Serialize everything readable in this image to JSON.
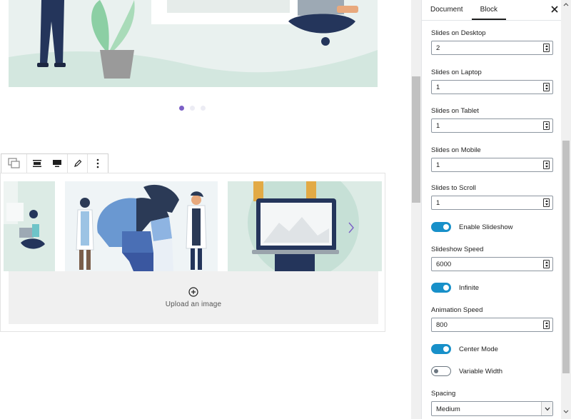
{
  "sidebar": {
    "tabs": [
      {
        "label": "Document",
        "active": false
      },
      {
        "label": "Block",
        "active": true
      }
    ],
    "close_icon": "close-icon",
    "fields": {
      "slides_desktop": {
        "label": "Slides on Desktop",
        "value": "2"
      },
      "slides_laptop": {
        "label": "Slides on Laptop",
        "value": "1"
      },
      "slides_tablet": {
        "label": "Slides on Tablet",
        "value": "1"
      },
      "slides_mobile": {
        "label": "Slides on Mobile",
        "value": "1"
      },
      "slides_scroll": {
        "label": "Slides to Scroll",
        "value": "1"
      },
      "slideshow_speed": {
        "label": "Slideshow Speed",
        "value": "6000"
      },
      "animation_speed": {
        "label": "Animation Speed",
        "value": "800"
      }
    },
    "toggles": {
      "enable_slideshow": {
        "label": "Enable Slideshow",
        "on": true
      },
      "infinite": {
        "label": "Infinite",
        "on": true
      },
      "center_mode": {
        "label": "Center Mode",
        "on": true
      },
      "variable_width": {
        "label": "Variable Width",
        "on": false
      }
    },
    "spacing": {
      "label": "Spacing",
      "selected": "Medium"
    }
  },
  "editor": {
    "carousel_dots": {
      "count": 3,
      "active_index": 0
    },
    "block_toolbar": [
      "gallery-icon",
      "align-center-icon",
      "align-wide-icon",
      "pencil-icon",
      "more-vertical-icon"
    ],
    "upload": {
      "label": "Upload an image",
      "icon": "plus-circle-icon"
    },
    "next_arrow": "chevron-right-icon"
  },
  "colors": {
    "toggle_on": "#1890c9",
    "active_dot": "#7b5fc6",
    "navy": "#24355b"
  }
}
